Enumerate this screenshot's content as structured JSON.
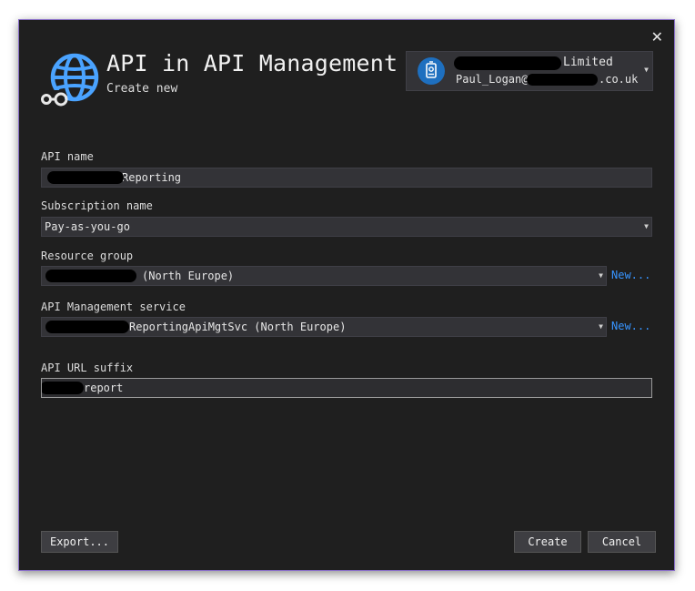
{
  "dialog": {
    "title": "API in API Management",
    "subtitle": "Create new",
    "close_glyph": "✕"
  },
  "account": {
    "name_suffix": "Limited",
    "email_prefix": "Paul_Logan@",
    "email_suffix": ".co.uk",
    "avatar_icon": "account-badge-icon"
  },
  "fields": {
    "api_name": {
      "label": "API name",
      "value": "Reporting"
    },
    "subscription": {
      "label": "Subscription name",
      "value": "Pay-as-you-go"
    },
    "resource_group": {
      "label": "Resource group",
      "value": "(North Europe)",
      "new_link": "New..."
    },
    "apim_service": {
      "label": "API Management service",
      "value": "ReportingApiMgtSvc (North Europe)",
      "new_link": "New..."
    },
    "url_suffix": {
      "label": "API URL suffix",
      "value": "report"
    }
  },
  "buttons": {
    "export": "Export...",
    "create": "Create",
    "cancel": "Cancel"
  },
  "colors": {
    "background": "#1f1f1f",
    "accent_border": "#8a6fc9",
    "link": "#3794ff",
    "globe_icon": "#4aa3ff"
  }
}
